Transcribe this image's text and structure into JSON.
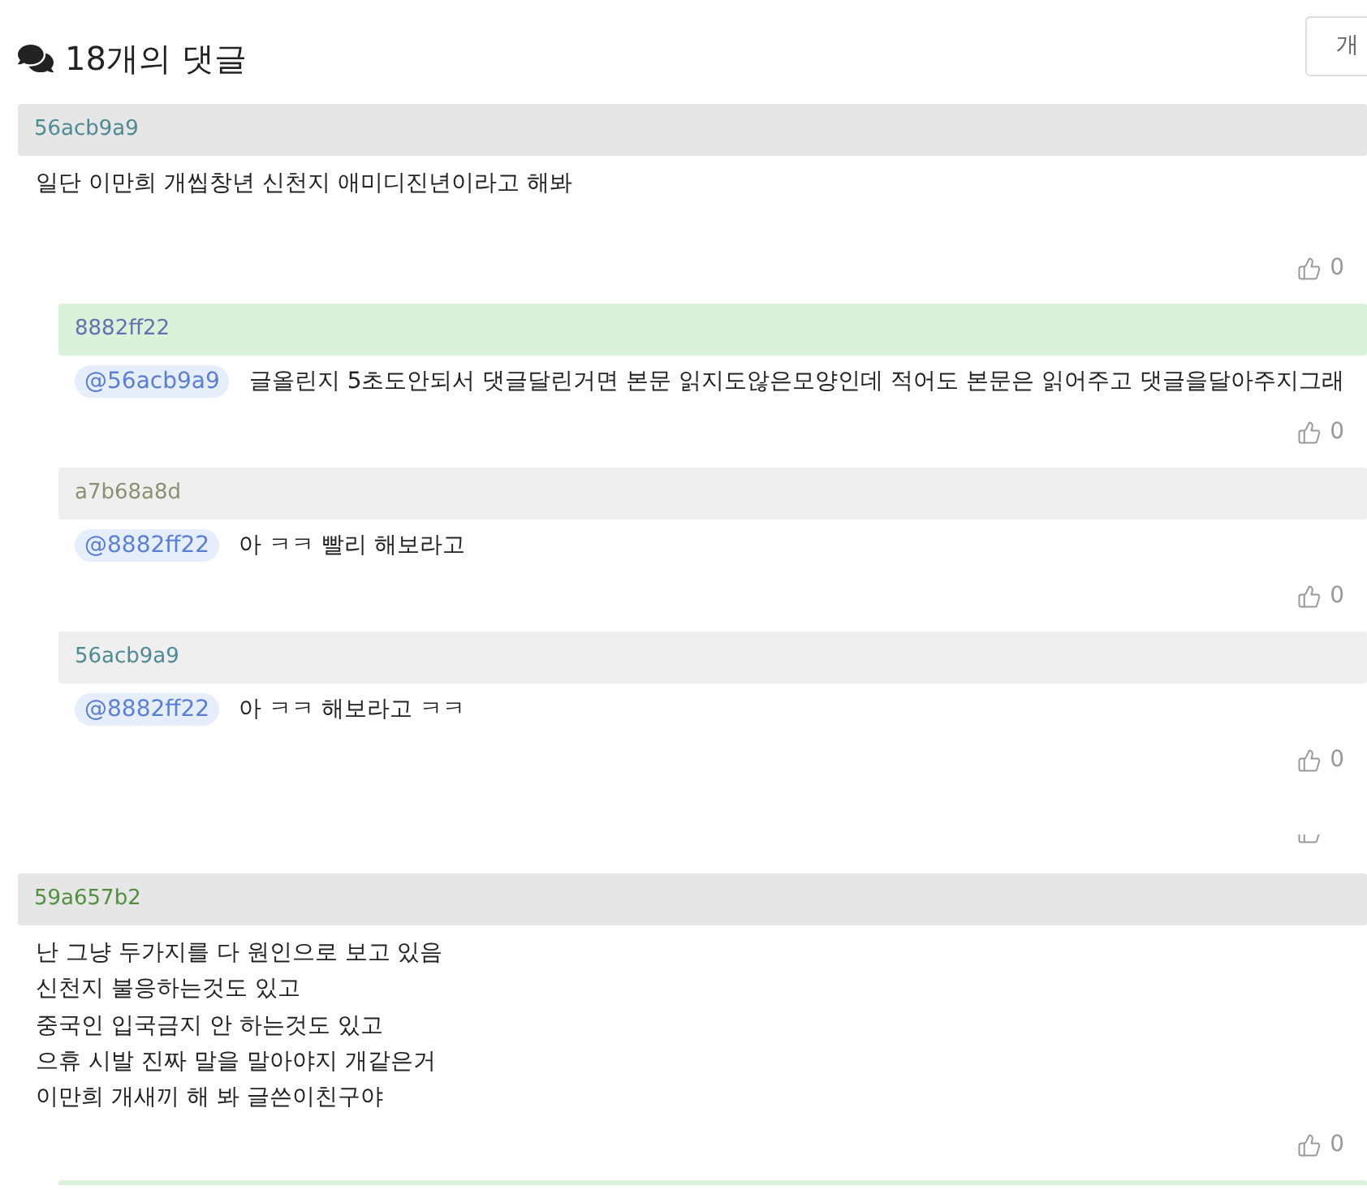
{
  "header": {
    "title": "18개의 댓글",
    "sort_button": "개"
  },
  "comments": [
    {
      "author": "56acb9a9",
      "color": "#4c8a93",
      "lines": [
        "일단 이만희 개씹창년 신천지 애미디진년이라고 해봐"
      ],
      "likes": "0",
      "replies": [
        {
          "author": "8882ff22",
          "color": "#6670b0",
          "highlighted": true,
          "mention": "@56acb9a9",
          "text": "글올린지 5초도안되서 댓글달린거면 본문 읽지도않은모양인데 적어도 본문은 읽어주고 댓글을달아주지그래",
          "likes": "0"
        },
        {
          "author": "a7b68a8d",
          "color": "#8c9072",
          "highlighted": false,
          "mention": "@8882ff22",
          "text": "아 ㅋㅋ 빨리 해보라고",
          "likes": "0"
        },
        {
          "author": "56acb9a9",
          "color": "#4c8a93",
          "highlighted": false,
          "mention": "@8882ff22",
          "text": "아 ㅋㅋ 해보라고 ㅋㅋ",
          "likes": "0"
        }
      ]
    },
    {
      "author": "59a657b2",
      "color": "#4f8f3e",
      "lines": [
        "난 그냥 두가지를 다 원인으로 보고 있음",
        "신천지 불응하는것도 있고",
        "중국인 입국금지 안 하는것도 있고",
        "으휴 시발 진짜 말을 말아야지 개같은거",
        "이만희 개새끼 해 봐 글쓴이친구야"
      ],
      "likes": "0",
      "replies": [
        {
          "highlighted": true
        }
      ]
    }
  ]
}
